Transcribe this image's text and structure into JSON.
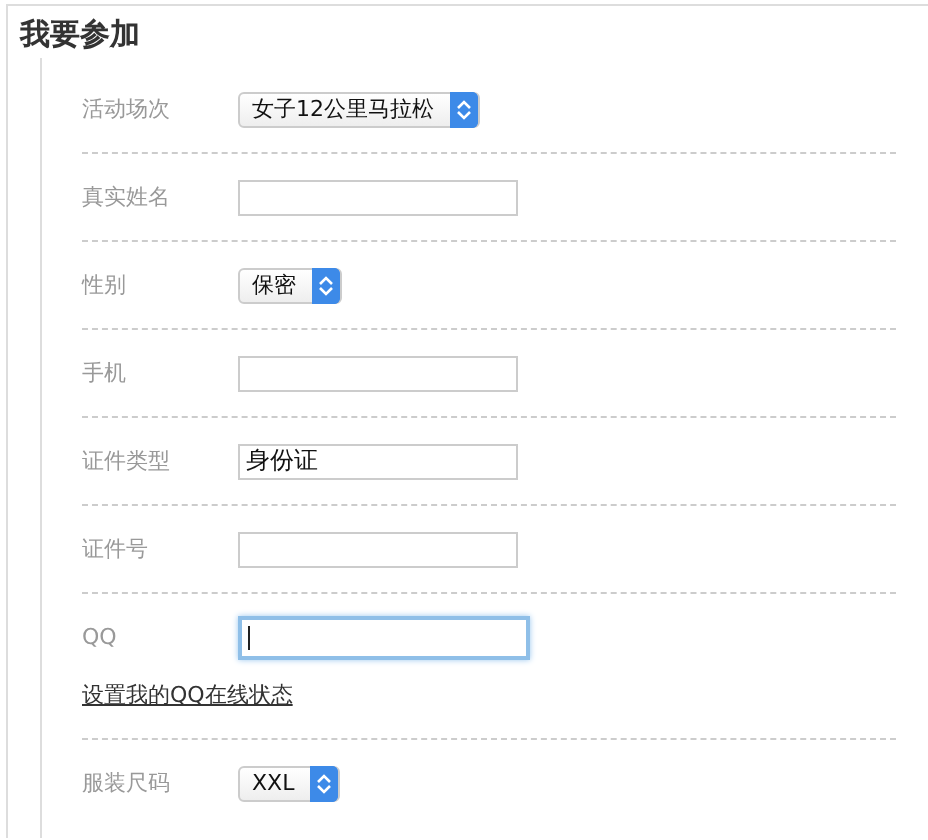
{
  "title": "我要参加",
  "fields": [
    {
      "kind": "select",
      "label": "活动场次",
      "value": "女子12公里马拉松"
    },
    {
      "kind": "input",
      "label": "真实姓名",
      "focused": false
    },
    {
      "kind": "select",
      "label": "性别",
      "value": "保密"
    },
    {
      "kind": "input",
      "label": "手机",
      "focused": false
    },
    {
      "kind": "input",
      "label": "证件类型",
      "value": "身份证",
      "focused": false
    },
    {
      "kind": "input",
      "label": "证件号",
      "focused": false
    },
    {
      "kind": "input",
      "label": "QQ",
      "focused": true,
      "link": "设置我的QQ在线状态"
    },
    {
      "kind": "select",
      "label": "服装尺码",
      "value": "XXL"
    }
  ]
}
